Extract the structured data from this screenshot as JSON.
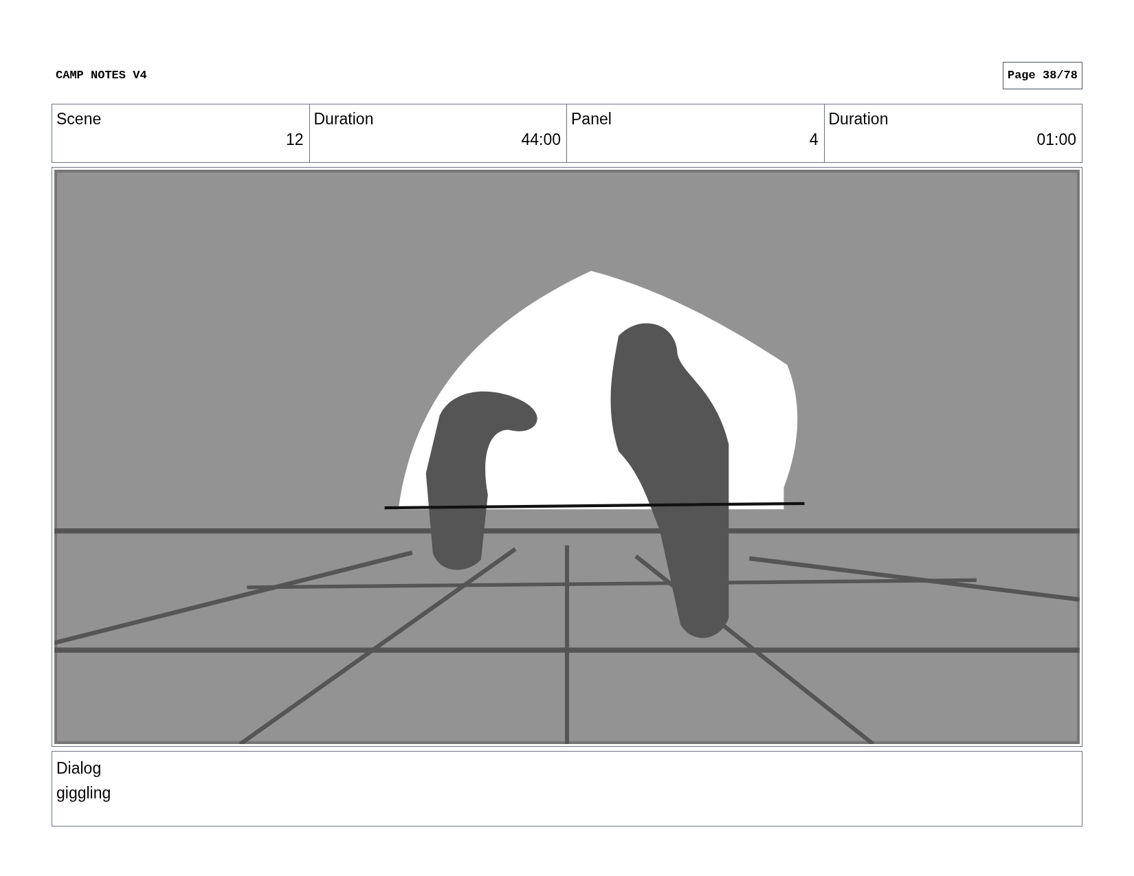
{
  "header": {
    "title": "CAMP NOTES V4",
    "page": "Page 38/78"
  },
  "info_table": {
    "columns": [
      "Scene",
      "Duration",
      "Panel",
      "Duration"
    ],
    "row": [
      "12",
      "44:00",
      "4",
      "01:00"
    ]
  },
  "dialog": {
    "label": "Dialog",
    "text": "giggling"
  }
}
